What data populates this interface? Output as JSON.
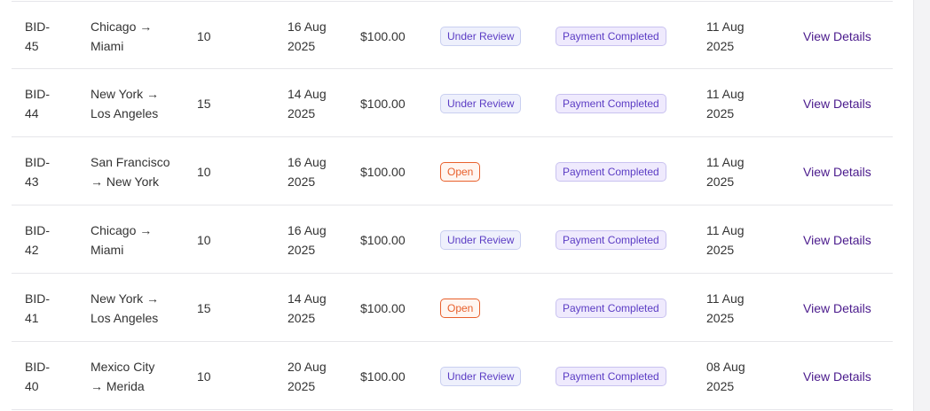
{
  "colors": {
    "link": "#4a1a8c",
    "review_badge_text": "#5b3cc4",
    "open_badge_text": "#e8602c",
    "payment_badge_text": "#5b3cc4",
    "row_divider": "#e6e6ea"
  },
  "rows": [
    {
      "id_line1": "BID-",
      "id_line2": "45",
      "route_line1": "Chicago →",
      "route_line2": "Miami",
      "quantity": "10",
      "deadline_line1": "16 Aug",
      "deadline_line2": "2025",
      "amount": "$100.00",
      "status": "Under Review",
      "payment": "Payment Completed",
      "created_line1": "11 Aug",
      "created_line2": "2025",
      "action": "View Details"
    },
    {
      "id_line1": "BID-",
      "id_line2": "44",
      "route_line1": "New York →",
      "route_line2": "Los Angeles",
      "quantity": "15",
      "deadline_line1": "14 Aug",
      "deadline_line2": "2025",
      "amount": "$100.00",
      "status": "Under Review",
      "payment": "Payment Completed",
      "created_line1": "11 Aug",
      "created_line2": "2025",
      "action": "View Details"
    },
    {
      "id_line1": "BID-",
      "id_line2": "43",
      "route_line1": "San Francisco",
      "route_line2": "→ New York",
      "quantity": "10",
      "deadline_line1": "16 Aug",
      "deadline_line2": "2025",
      "amount": "$100.00",
      "status": "Open",
      "payment": "Payment Completed",
      "created_line1": "11 Aug",
      "created_line2": "2025",
      "action": "View Details"
    },
    {
      "id_line1": "BID-",
      "id_line2": "42",
      "route_line1": "Chicago →",
      "route_line2": "Miami",
      "quantity": "10",
      "deadline_line1": "16 Aug",
      "deadline_line2": "2025",
      "amount": "$100.00",
      "status": "Under Review",
      "payment": "Payment Completed",
      "created_line1": "11 Aug",
      "created_line2": "2025",
      "action": "View Details"
    },
    {
      "id_line1": "BID-",
      "id_line2": "41",
      "route_line1": "New York →",
      "route_line2": "Los Angeles",
      "quantity": "15",
      "deadline_line1": "14 Aug",
      "deadline_line2": "2025",
      "amount": "$100.00",
      "status": "Open",
      "payment": "Payment Completed",
      "created_line1": "11 Aug",
      "created_line2": "2025",
      "action": "View Details"
    },
    {
      "id_line1": "BID-",
      "id_line2": "40",
      "route_line1": "Mexico City",
      "route_line2": "→ Merida",
      "quantity": "10",
      "deadline_line1": "20 Aug",
      "deadline_line2": "2025",
      "amount": "$100.00",
      "status": "Under Review",
      "payment": "Payment Completed",
      "created_line1": "08 Aug",
      "created_line2": "2025",
      "action": "View Details"
    }
  ]
}
